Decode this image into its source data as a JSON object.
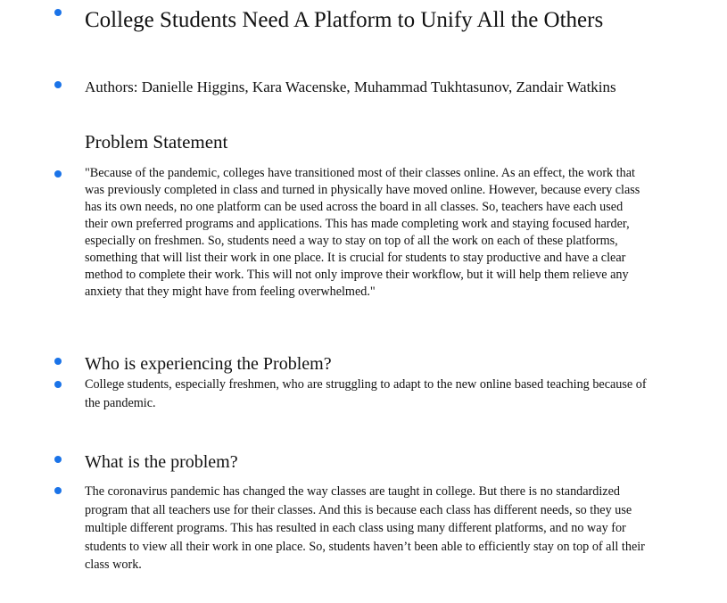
{
  "title": "College Students Need A Platform to Unify All the Others",
  "authors": "Authors: Danielle Higgins, Kara Wacenske, Muhammad Tukhtasunov, Zandair Watkins",
  "problem_statement": {
    "heading": "Problem Statement",
    "text": "\"Because of the pandemic, colleges have transitioned most of their classes online. As an effect, the work that was previously completed in class and turned in physically have moved online. However, because every class has its own needs, no one platform can be used across the board in all classes. So, teachers have each used their own preferred programs and applications. This has made completing work and staying focused harder, especially on freshmen. So, students need a way to stay on top of all the work on each of these platforms, something that will list their work in one place. It is crucial for students to stay productive and have a clear method to complete their work. This will not only improve their workflow, but it will help them relieve any anxiety that they might have from feeling overwhelmed.\""
  },
  "who": {
    "heading": "Who is experiencing the Problem?",
    "text": "College students, especially freshmen, who are struggling to adapt to the new online based teaching because of the pandemic."
  },
  "what": {
    "heading": "What is the problem?",
    "text": "The coronavirus pandemic has changed the way classes are taught in college. But there is no standardized program that all teachers use for their classes. And this is because each class has different needs, so they use multiple different programs. This has resulted in each class using many different platforms, and no way for students to view all their work in one place. So, students haven’t been able to efficiently stay on top of all their class work."
  },
  "colors": {
    "bullet": "#1a73e8",
    "text": "#111111"
  }
}
